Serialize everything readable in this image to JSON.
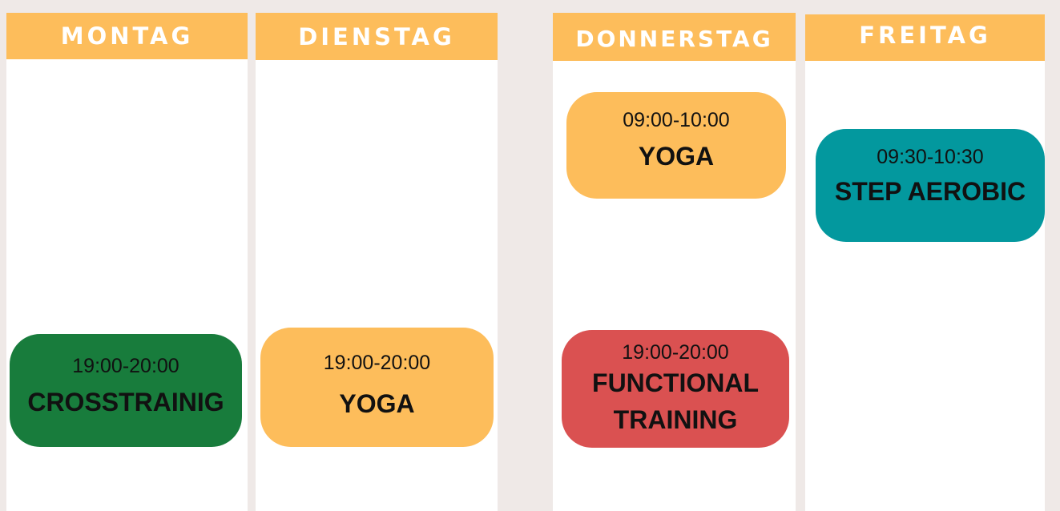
{
  "days": [
    {
      "name": "MONTAG"
    },
    {
      "name": "DIENSTAG"
    },
    {
      "name": "DONNERSTAG"
    },
    {
      "name": "FREITAG"
    }
  ],
  "classes": [
    {
      "time": "19:00-20:00",
      "name": "CROSSTRAINIG",
      "color": "#187c3c"
    },
    {
      "time": "19:00-20:00",
      "name": "YOGA",
      "color": "#fdbd5b"
    },
    {
      "time": "09:00-10:00",
      "name": "YOGA",
      "color": "#fdbd5b"
    },
    {
      "time": "19:00-20:00",
      "name_line1": "FUNCTIONAL",
      "name_line2": "TRAINING",
      "color": "#da5151"
    },
    {
      "time": "09:30-10:30",
      "name": "STEP AEROBIC",
      "color": "#03989e"
    }
  ],
  "colors": {
    "background": "#efe9e7",
    "column": "#ffffff",
    "header": "#fdbd5b",
    "header_text": "#ffffff"
  }
}
